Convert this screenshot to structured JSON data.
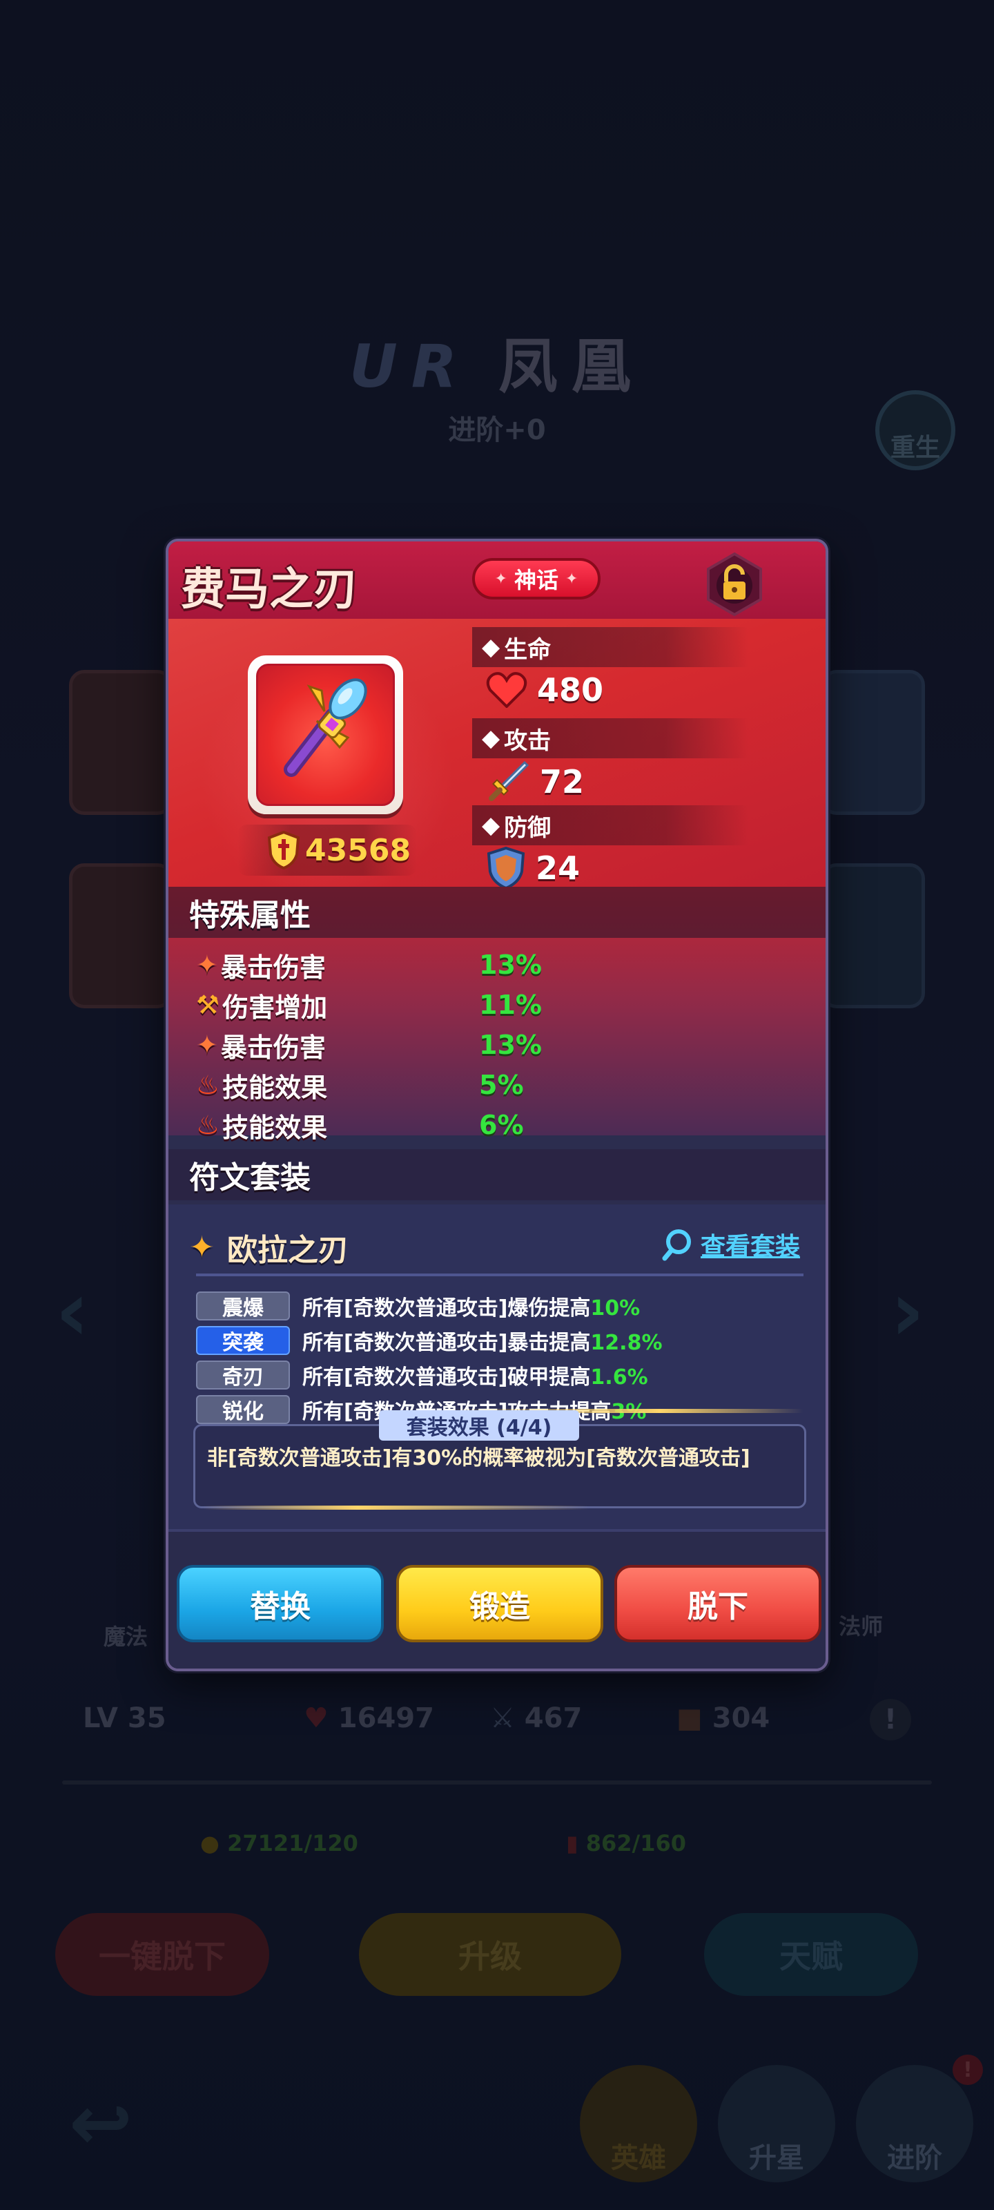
{
  "background": {
    "title_rarity": "UR",
    "title_name": "凤凰",
    "subtitle": "进阶+0",
    "rebirth_label": "重生",
    "class_left": "魔法",
    "class_right": "法师",
    "level_label": "LV",
    "level": "35",
    "hp": "16497",
    "atk": "467",
    "def": "304",
    "gold": "27121/120",
    "potion": "862/160",
    "unequip_all": "一键脱下",
    "upgrade": "升级",
    "talent": "天赋",
    "tab_hero": "英雄",
    "tab_star": "升星",
    "tab_advance": "进阶",
    "notify_badge": "!"
  },
  "item": {
    "name": "费马之刃",
    "tier": "神话",
    "power": "43568"
  },
  "stats": {
    "hp_label": "生命",
    "hp_value": "480",
    "atk_label": "攻击",
    "atk_value": "72",
    "def_label": "防御",
    "def_value": "24"
  },
  "special": {
    "title": "特殊属性",
    "rows": [
      {
        "label": "暴击伤害",
        "value": "13%",
        "icon": "crit-icon"
      },
      {
        "label": "伤害增加",
        "value": "11%",
        "icon": "damage-up-icon"
      },
      {
        "label": "暴击伤害",
        "value": "13%",
        "icon": "crit-icon"
      },
      {
        "label": "技能效果",
        "value": "5%",
        "icon": "fire-icon"
      },
      {
        "label": "技能效果",
        "value": "6%",
        "icon": "fire-icon"
      }
    ]
  },
  "rune": {
    "section_title": "符文套装",
    "set_name": "欧拉之刃",
    "view_set": "查看套装",
    "rows": [
      {
        "tag": "震爆",
        "desc": "所有[奇数次普通攻击]爆伤提高",
        "value": "10%",
        "active": false
      },
      {
        "tag": "突袭",
        "desc": "所有[奇数次普通攻击]暴击提高",
        "value": "12.8%",
        "active": true
      },
      {
        "tag": "奇刃",
        "desc": "所有[奇数次普通攻击]破甲提高",
        "value": "1.6%",
        "active": false
      },
      {
        "tag": "锐化",
        "desc": "所有[奇数次普通攻击]攻击力提高",
        "value": "3%",
        "active": false
      }
    ],
    "set_effect_title": "套装效果 (4/4)",
    "set_effect_desc": "非[奇数次普通攻击]有30%的概率被视为[奇数次普通攻击]"
  },
  "buttons": {
    "replace": "替换",
    "forge": "锻造",
    "unequip": "脱下"
  },
  "colors": {
    "header_red": "#c21e44",
    "value_green": "#35e53f",
    "link_blue": "#52d2ff",
    "power_gold": "#ffd54a"
  }
}
